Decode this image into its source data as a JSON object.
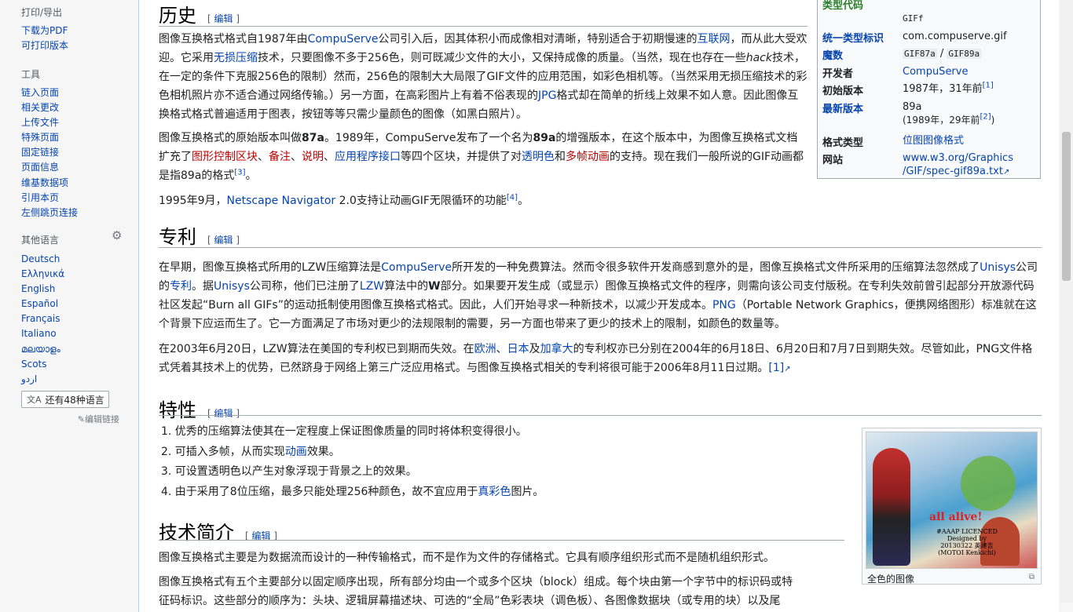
{
  "sidebar": {
    "print_heading": "打印/导出",
    "print_items": [
      "下载为PDF",
      "可打印版本"
    ],
    "tools_heading": "工具",
    "tools_items": [
      "链入页面",
      "相关更改",
      "上传文件",
      "特殊页面",
      "固定链接",
      "页面信息",
      "维基数据项",
      "引用本页",
      "左侧跳页连接"
    ],
    "lang_heading": "其他语言",
    "languages": [
      "Deutsch",
      "Ελληνικά",
      "English",
      "Español",
      "Français",
      "Italiano",
      "മലയാളം",
      "Scots",
      "اردو"
    ],
    "more_languages": "还有48种语言",
    "edit_links": "编辑链接",
    "settings_icon": "gear-icon",
    "translate_icon": "translate-icon"
  },
  "edit_label": "编辑",
  "sections": {
    "history": {
      "title": "历史",
      "p1": [
        "图像互换格式格式自1987年由",
        "CompuServe",
        "公司引入后，因其体积小而成像相对清晰，特别适合于初期慢速的",
        "互联网",
        "，而从此大受欢迎。它采用",
        "无损压缩",
        "技术，只要图像不多于256色，则可既减少文件的大小，又保持成像的质量。（当然，现在也存在一些",
        "hack",
        "技术，在一定的条件下克服256色的限制）然而，256色的限制大大局限了GIF文件的应用范围，如彩色相机等。（当然采用无损压缩技术的彩色相机照片亦不适合通过网络传输。）另一方面，在高彩图片上有着不俗表现的",
        "JPG",
        "格式却在简单的折线上效果不如人意。因此图像互换格式格式普遍适用于图表，按钮等等只需少量颜色的图像（如黑白照片）。"
      ],
      "p2": [
        "图像互换格式的原始版本叫做",
        "87a",
        "。1989年，CompuServe发布了一个名为",
        "89a",
        "的增强版本，在这个版本中，为图像互换格式文档扩充了",
        "图形控制区块",
        "、",
        "备注",
        "、",
        "说明",
        "、",
        "应用程序接口",
        "等四个区块，并提供了对",
        "透明色",
        "和",
        "多帧动画",
        "的支持。现在我们一般所说的GIF动画都是指89a的格式",
        "[3]",
        "。"
      ],
      "p3": [
        "1995年9月，",
        "Netscape Navigator",
        " 2.0支持让动画GIF无限循环的功能",
        "[4]",
        "。"
      ]
    },
    "patent": {
      "title": "专利",
      "p1": [
        "在早期，图像互换格式所用的LZW压缩算法是",
        "CompuServe",
        "所开发的一种免费算法。然而令很多软件开发商感到意外的是，图像互换格式文件所采用的压缩算法忽然成了",
        "Unisys",
        "公司的",
        "专利",
        "。据",
        "Unisys",
        "公司称，他们已注册了",
        "LZW",
        "算法中的",
        "W",
        "部分。如果要开发生成（或显示）图像互换格式文件的程序，则需向该公司支付版税。在专利失效前曾引起部分开放源代码社区发起“Burn all GIFs”的运动抵制使用图像互换格式格式。因此，人们开始寻求一种新技术，以减少开发成本。",
        "PNG",
        "（Portable Network Graphics，便携网络图形）标准就在这个背景下应运而生了。它一方面满足了市场对更少的法规限制的需要，另一方面也带来了更少的技术上的限制，如颜色的数量等。"
      ],
      "p2": [
        "在2003年6月20日，LZW算法在美国的专利权已到期而失效。在",
        "欧洲",
        "、",
        "日本",
        "及",
        "加拿大",
        "的专利权亦已分别在2004年的6月18日、6月20日和7月7日到期失效。尽管如此，PNG文件格式凭着其技术上的优势，已然跻身于网络上第三广泛应用格式。与图像互换格式相关的专利将很可能于2006年8月11日过期。",
        "[1]"
      ]
    },
    "features": {
      "title": "特性",
      "items": [
        [
          "1. 优秀的压缩算法使其在一定程度上保证图像质量的同时将体积变得很小。"
        ],
        [
          "2. 可插入多帧，从而实现",
          "动画",
          "效果。"
        ],
        [
          "3. 可设置透明色以产生对象浮现于背景之上的效果。"
        ],
        [
          "4. 由于采用了8位压缩，最多只能处理256种颜色，故不宜应用于",
          "真彩色",
          "图片。"
        ]
      ]
    },
    "tech": {
      "title": "技术简介",
      "p1": "图像互换格式主要是为数据流而设计的一种传输格式，而不是作为文件的存储格式。它具有顺序组织形式而不是随机组织形式。",
      "p2a": "图像互换格式有五个主要部分以固定顺序出现，所有部分均由一个或多个区块（block）组成。每个块由第一个字节中的标识码或特",
      "p2b": "征码标识。这些部分的顺序为：头块、逻辑屏幕描述块、可选的“全局”色彩表块（调色板）、各图像数据块（或专用的块）以及尾"
    }
  },
  "infobox": {
    "type_code_label": "类型代码",
    "type_code": "GIFf",
    "uti_label": "统一类型标识",
    "uti": "com.compuserve.gif",
    "magic_label": "魔数",
    "magic_a": "GIF87a",
    "magic_sep": " / ",
    "magic_b": "GIF89a",
    "developer_label": "开发者",
    "developer": "CompuServe",
    "initial_label": "初始版本",
    "initial": "1987年，31年前",
    "initial_ref": "[1]",
    "latest_label": "最新版本",
    "latest": "89a",
    "latest_date": "(1989年，29年前",
    "latest_ref": "[2]",
    "latest_close": ")",
    "format_type_label": "格式类型",
    "format_type": "位图图像格式",
    "website_label": "网站",
    "website_1": "www.w3.org/Graphics",
    "website_2": "/GIF/spec-gif89a.txt",
    "external_icon": "external-link-icon"
  },
  "thumb": {
    "caption": "全色的图像",
    "image_text": [
      "all alive!",
      "#AAAP LICENCED",
      "Designed by",
      "20130322 英建吉",
      "(MOTOI Kenkichi)"
    ],
    "enlarge_icon": "enlarge-icon"
  },
  "colors": {
    "link": "#0645ad",
    "new_link": "#ba0000",
    "text": "#202122"
  }
}
